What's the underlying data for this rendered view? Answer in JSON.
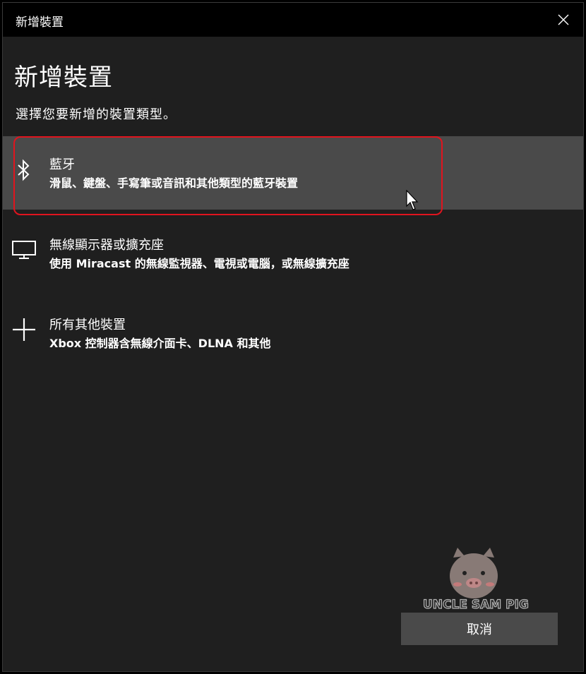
{
  "window": {
    "title": "新增裝置",
    "heading": "新增裝置",
    "subtitle": "選擇您要新增的裝置類型。"
  },
  "options": [
    {
      "icon": "bluetooth-icon",
      "title": "藍牙",
      "description": "滑鼠、鍵盤、手寫筆或音訊和其他類型的藍牙裝置",
      "selected": true
    },
    {
      "icon": "monitor-icon",
      "title": "無線顯示器或擴充座",
      "description": "使用 Miracast 的無線監視器、電視或電腦，或無線擴充座",
      "selected": false
    },
    {
      "icon": "plus-icon",
      "title": "所有其他裝置",
      "description": "Xbox 控制器含無線介面卡、DLNA 和其他",
      "selected": false
    }
  ],
  "watermark": {
    "text": "UNCLE SAM PIG"
  },
  "buttons": {
    "cancel": "取消"
  },
  "colors": {
    "highlight": "#e0141e",
    "selected_bg": "#4a4a4a",
    "background": "#1f1f1f"
  }
}
